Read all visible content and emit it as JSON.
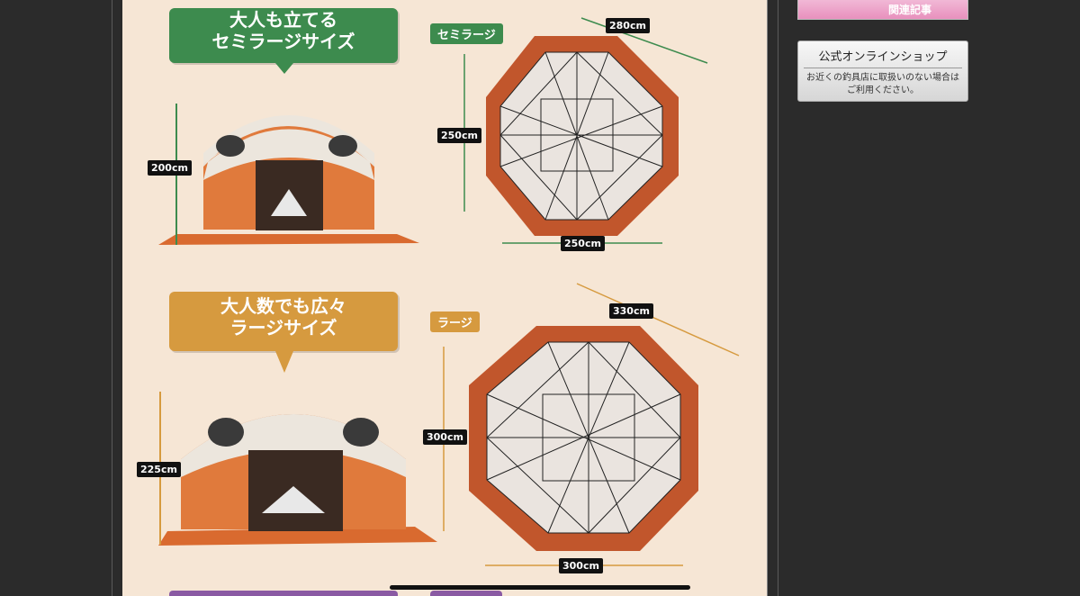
{
  "promo": {
    "semi": {
      "headline_line1": "大人も立てる",
      "headline_line2": "セミラージサイズ",
      "tag": "セミラージ",
      "height": "200cm",
      "diagonal": "280cm",
      "depth": "250cm",
      "width": "250cm"
    },
    "large": {
      "headline_line1": "大人数でも広々",
      "headline_line2": "ラージサイズ",
      "tag": "ラージ",
      "height": "225cm",
      "diagonal": "330cm",
      "depth": "300cm",
      "width": "300cm"
    }
  },
  "sidebar": {
    "banner_label": "関連記事",
    "shop_title": "公式オンラインショップ",
    "shop_desc_line1": "お近くの釣具店に取扱いのない場合は",
    "shop_desc_line2": "ご利用ください。"
  },
  "colors": {
    "green": "#3d8b4e",
    "orange_bubble": "#d69a3f",
    "tent_orange": "#d96a2f",
    "tent_floor_frame": "#c1562c",
    "page_bg": "#f6e6d5"
  }
}
